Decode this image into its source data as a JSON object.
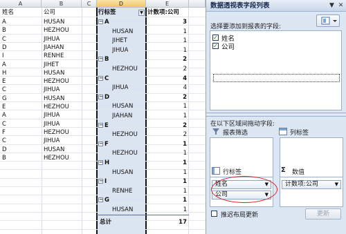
{
  "sheet": {
    "columns": [
      {
        "letter": "A"
      },
      {
        "letter": "B"
      },
      {
        "letter": "C"
      },
      {
        "letter": "D"
      },
      {
        "letter": "E"
      }
    ],
    "source_header": {
      "name": "姓名",
      "company": "公司"
    },
    "source_rows": [
      {
        "name": "A",
        "company": "HUSAN"
      },
      {
        "name": "B",
        "company": "HEZHOU"
      },
      {
        "name": "C",
        "company": "JIHUA"
      },
      {
        "name": "D",
        "company": "JIAHAN"
      },
      {
        "name": "I",
        "company": "RENHE"
      },
      {
        "name": "A",
        "company": "JIHET"
      },
      {
        "name": "H",
        "company": "HUSAN"
      },
      {
        "name": "E",
        "company": "HEZHOU"
      },
      {
        "name": "C",
        "company": "JIHUA"
      },
      {
        "name": "G",
        "company": "HUSAN"
      },
      {
        "name": "E",
        "company": "HEZHOU"
      },
      {
        "name": "A",
        "company": "JIHUA"
      },
      {
        "name": "C",
        "company": "JIHUA"
      },
      {
        "name": "F",
        "company": "HEZHOU"
      },
      {
        "name": "C",
        "company": "JIHUA"
      },
      {
        "name": "D",
        "company": "HUSAN"
      },
      {
        "name": "B",
        "company": "HEZHOU"
      }
    ],
    "pivot": {
      "row_label_header": "行标签",
      "count_header": "计数项:公司",
      "rows": [
        {
          "label": "A",
          "count": "3",
          "group": true
        },
        {
          "label": "HUSAN",
          "count": "1",
          "group": false
        },
        {
          "label": "JIHET",
          "count": "1",
          "group": false
        },
        {
          "label": "JIHUA",
          "count": "1",
          "group": false
        },
        {
          "label": "B",
          "count": "2",
          "group": true
        },
        {
          "label": "HEZHOU",
          "count": "2",
          "group": false
        },
        {
          "label": "C",
          "count": "4",
          "group": true
        },
        {
          "label": "JIHUA",
          "count": "4",
          "group": false
        },
        {
          "label": "D",
          "count": "2",
          "group": true
        },
        {
          "label": "HUSAN",
          "count": "1",
          "group": false
        },
        {
          "label": "JIAHAN",
          "count": "1",
          "group": false
        },
        {
          "label": "E",
          "count": "2",
          "group": true
        },
        {
          "label": "HEZHOU",
          "count": "2",
          "group": false
        },
        {
          "label": "F",
          "count": "1",
          "group": true
        },
        {
          "label": "HEZHOU",
          "count": "1",
          "group": false
        },
        {
          "label": "H",
          "count": "1",
          "group": true
        },
        {
          "label": "HUSAN",
          "count": "1",
          "group": false
        },
        {
          "label": "I",
          "count": "1",
          "group": true
        },
        {
          "label": "RENHE",
          "count": "1",
          "group": false
        },
        {
          "label": "G",
          "count": "1",
          "group": true
        },
        {
          "label": "HUSAN",
          "count": "1",
          "group": false
        }
      ],
      "total_label": "总计",
      "total_count": "17"
    }
  },
  "pane": {
    "title": "数据透视表字段列表",
    "choose_fields_label": "选择要添加到报表的字段:",
    "fields": [
      {
        "name": "姓名",
        "checked": true
      },
      {
        "name": "公司",
        "checked": true
      }
    ],
    "drag_label": "在以下区域间拖动字段:",
    "report_filter_label": "报表筛选",
    "column_labels_label": "列标签",
    "row_labels_label": "行标签",
    "values_label": "数值",
    "row_items": [
      "姓名",
      "公司"
    ],
    "value_items": [
      "计数项:公司"
    ],
    "defer_update_label": "推迟布局更新",
    "update_button": "更新",
    "sigma_symbol": "Σ",
    "check_mark": "✓"
  },
  "colors": {
    "selected_column_bg": "#dbe4f1",
    "pane_bg": "#dde6f3",
    "highlight_ellipse": "#d2232a"
  }
}
